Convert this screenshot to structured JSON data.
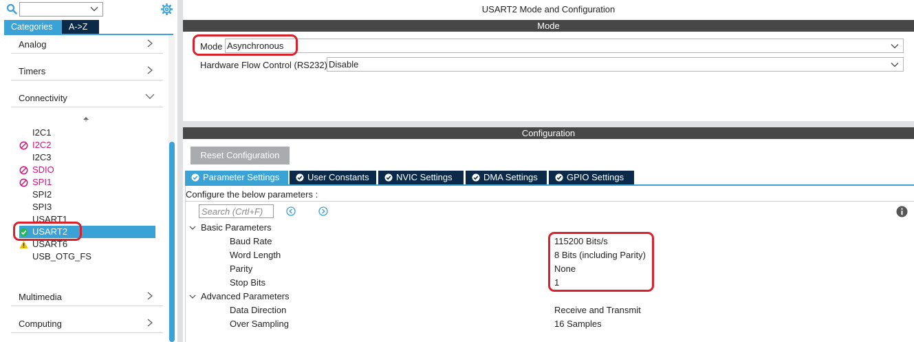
{
  "left_panel": {
    "search_value": "",
    "tabs": [
      "Categories",
      "A->Z"
    ],
    "categories": [
      {
        "label": "Analog",
        "state": "collapsed"
      },
      {
        "label": "Timers",
        "state": "collapsed"
      },
      {
        "label": "Connectivity",
        "state": "expanded"
      },
      {
        "label": "Multimedia",
        "state": "collapsed"
      },
      {
        "label": "Computing",
        "state": "collapsed"
      }
    ],
    "peripherals": [
      {
        "label": "I2C1",
        "status": "available"
      },
      {
        "label": "I2C2",
        "status": "conflict"
      },
      {
        "label": "I2C3",
        "status": "available"
      },
      {
        "label": "SDIO",
        "status": "conflict"
      },
      {
        "label": "SPI1",
        "status": "conflict"
      },
      {
        "label": "SPI2",
        "status": "available"
      },
      {
        "label": "SPI3",
        "status": "available"
      },
      {
        "label": "USART1",
        "status": "available"
      },
      {
        "label": "USART2",
        "status": "configured-selected"
      },
      {
        "label": "USART6",
        "status": "warning"
      },
      {
        "label": "USB_OTG_FS",
        "status": "available"
      }
    ]
  },
  "main": {
    "title": "USART2 Mode and Configuration",
    "mode_section_title": "Mode",
    "mode_label": "Mode",
    "mode_value": "Asynchronous",
    "hw_flow_label": "Hardware Flow Control (RS232)",
    "hw_flow_value": "Disable",
    "config_section_title": "Configuration",
    "reset_label": "Reset Configuration",
    "tabs": [
      "Parameter Settings",
      "User Constants",
      "NVIC Settings",
      "DMA Settings",
      "GPIO Settings"
    ],
    "hint": "Configure the below parameters :",
    "search_placeholder": "Search (Crtl+F)",
    "groups": [
      {
        "label": "Basic Parameters",
        "params": [
          {
            "name": "Baud Rate",
            "value": "115200 Bits/s"
          },
          {
            "name": "Word Length",
            "value": "8 Bits (including Parity)"
          },
          {
            "name": "Parity",
            "value": "None"
          },
          {
            "name": "Stop Bits",
            "value": "1"
          }
        ]
      },
      {
        "label": "Advanced Parameters",
        "params": [
          {
            "name": "Data Direction",
            "value": "Receive and Transmit"
          },
          {
            "name": "Over Sampling",
            "value": "16 Samples"
          }
        ]
      }
    ]
  },
  "colors": {
    "accent": "#3ba2d6",
    "dark_tab": "#0b2a4a",
    "section_band": "#474747",
    "conflict": "#d1147a",
    "warning": "#f2c200",
    "ok": "#2fb45a",
    "annotation": "#d8212a"
  }
}
